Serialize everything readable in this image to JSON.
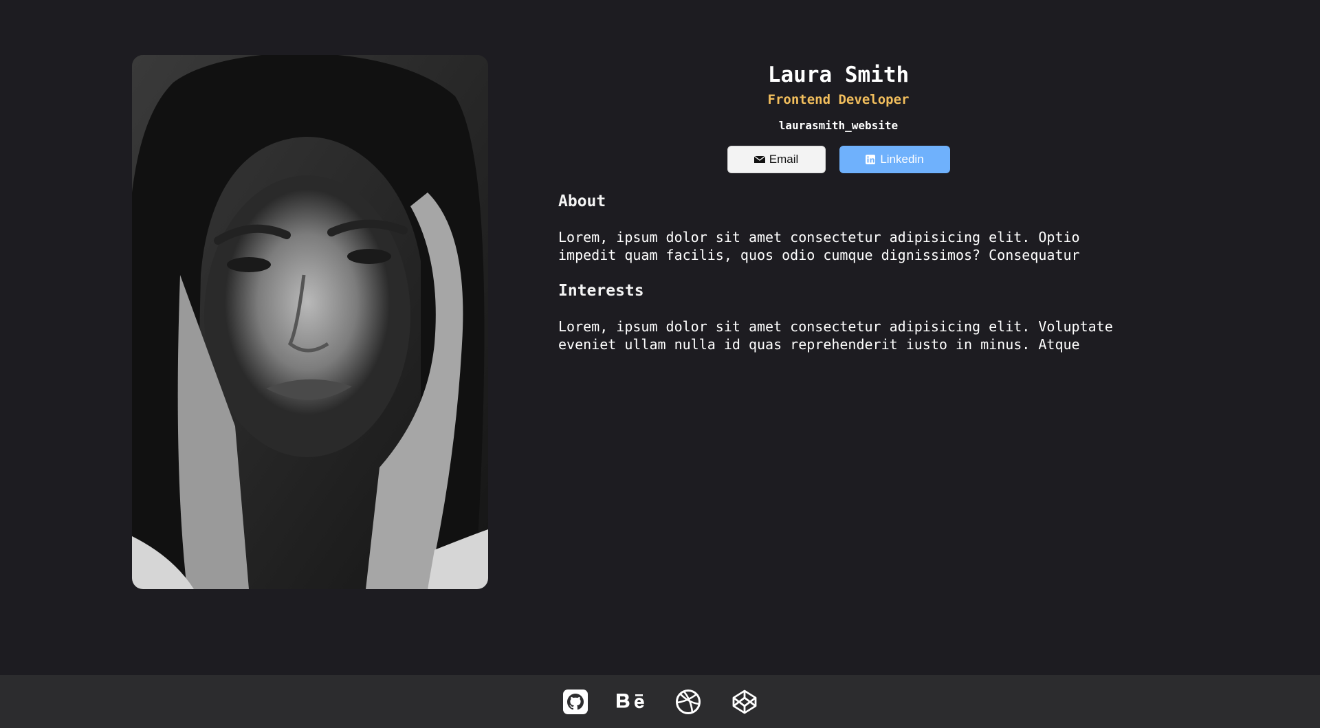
{
  "profile": {
    "name": "Laura Smith",
    "role": "Frontend Developer",
    "website": "laurasmith_website",
    "photo_icon": "portrait-photo"
  },
  "buttons": {
    "email_label": "Email",
    "email_icon": "envelope-icon",
    "linkedin_label": "Linkedin",
    "linkedin_icon": "linkedin-icon"
  },
  "about": {
    "heading": "About",
    "text": "Lorem, ipsum dolor sit amet consectetur adipisicing elit. Optio impedit quam facilis, quos odio cumque dignissimos? Consequatur"
  },
  "interests": {
    "heading": "Interests",
    "text": "Lorem, ipsum dolor sit amet consectetur adipisicing elit. Voluptate eveniet ullam nulla id quas reprehenderit iusto in minus. Atque"
  },
  "footer": {
    "icons": [
      "github-icon",
      "behance-icon",
      "dribbble-icon",
      "codepen-icon"
    ]
  },
  "colors": {
    "background": "#1d1c21",
    "footer": "#2c2c2e",
    "accent": "#f3bf5d",
    "linkedin": "#6fb1fc"
  }
}
